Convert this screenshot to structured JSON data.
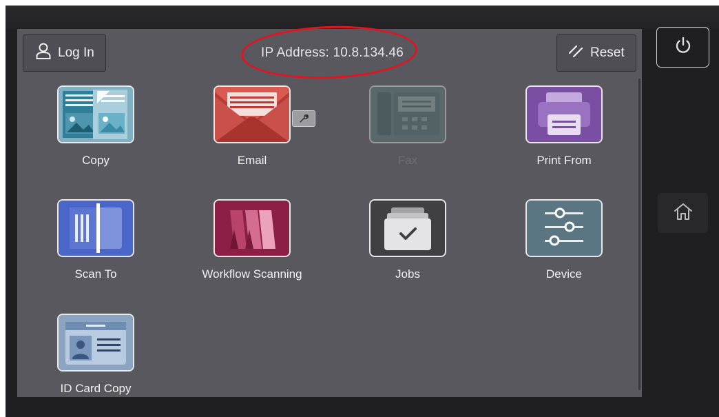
{
  "header": {
    "login_label": "Log In",
    "ip_address": "IP Address: 10.8.134.46",
    "reset_label": "Reset"
  },
  "apps": [
    {
      "label": "Copy",
      "icon": "copy-icon",
      "enabled": true
    },
    {
      "label": "Email",
      "icon": "email-icon",
      "enabled": true,
      "badge": "wrench-icon"
    },
    {
      "label": "Fax",
      "icon": "fax-icon",
      "enabled": false
    },
    {
      "label": "Print From",
      "icon": "printer-icon",
      "enabled": true
    },
    {
      "label": "Scan To",
      "icon": "scan-icon",
      "enabled": true
    },
    {
      "label": "Workflow Scanning",
      "icon": "workflow-scanning-icon",
      "enabled": true
    },
    {
      "label": "Jobs",
      "icon": "jobs-icon",
      "enabled": true
    },
    {
      "label": "Device",
      "icon": "device-settings-icon",
      "enabled": true
    },
    {
      "label": "ID Card Copy",
      "icon": "id-card-icon",
      "enabled": true
    }
  ],
  "side_buttons": {
    "power_icon": "power-icon",
    "home_icon": "home-icon"
  },
  "colors": {
    "screen_bg": "#59585e",
    "highlight_oval": "#e3141f",
    "copy_tile": "#7fb0c4",
    "email_tile": "#c0473f",
    "fax_tile": "#5a7f7c",
    "print_tile": "#7a4fa3",
    "scan_tile": "#4a66c9",
    "workflow_tile": "#8c1f45",
    "jobs_tile": "#3f3f44",
    "device_tile": "#5b7683",
    "idcard_tile": "#8aa4c2"
  }
}
